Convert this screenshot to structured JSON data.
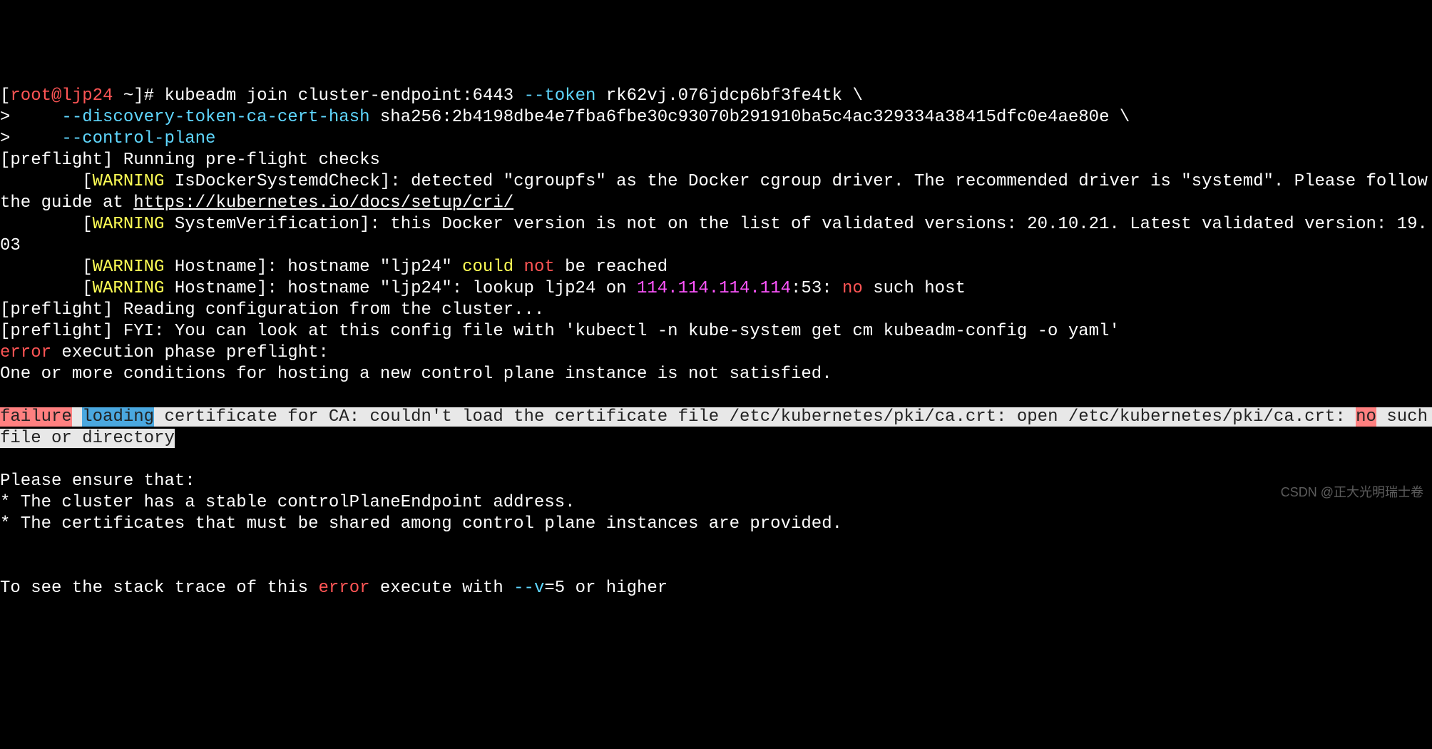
{
  "prompt": {
    "left_bracket": "[",
    "user": "root@ljp24",
    "tilde": " ~",
    "right_seg": "]# ",
    "cmd_kubeadm": "kubeadm ",
    "cmd_join": "join cluster-endpoint:6443 ",
    "flag_token": "--token",
    "token_val": " rk62vj.076jdcp6bf3fe4tk \\",
    "cont1_gt": ">     ",
    "flag_hash": "--discovery-token-ca-cert-hash",
    "hash_val": " sha256:2b4198dbe4e7fba6fbe30c93070b291910ba5c4ac329334a38415dfc0e4ae80e \\",
    "cont2_gt": ">     ",
    "flag_cp": "--control-plane"
  },
  "preflight": {
    "run": "[preflight] Running pre-flight checks",
    "w_open": "        [",
    "w_tag": "WARNING",
    "w1_rest": " IsDockerSystemdCheck]: detected \"cgroupfs\" as the Docker cgroup driver. The recommended driver is \"systemd\". Please follow the guide at ",
    "w1_link": "https://kubernetes.io/docs/setup/cri/",
    "w2_rest": " SystemVerification]: this Docker version is not on the list of validated versions: 20.10.21. Latest validated version: 19.03",
    "w3_rest_a": " Hostname]: hostname \"ljp24\" ",
    "w3_could": "could",
    "w3_sp": " ",
    "w3_not": "not",
    "w3_rest_b": " be reached",
    "w4_rest_a": " Hostname]: hostname \"ljp24\": lookup ljp24 on ",
    "w4_ip": "114.114.114.114",
    "w4_port": ":53: ",
    "w4_no": "no",
    "w4_rest_b": " such host",
    "read": "[preflight] Reading configuration from the cluster...",
    "fyi": "[preflight] FYI: You can look at this config file with 'kubectl -n kube-system get cm kubeadm-config -o yaml'"
  },
  "error": {
    "err_word": "error",
    "exec": " execution phase preflight: ",
    "cond": "One or more conditions for hosting a new control plane instance is not satisfied."
  },
  "failure": {
    "failure": "failure",
    "sp1": " ",
    "loading": "loading",
    "mid_a": " certificate for CA: couldn't load the certificate file /etc/kubernetes/pki/ca.crt: open /etc/kubernetes/pki/ca.crt: ",
    "no": "no",
    "mid_b": " such file or directory"
  },
  "ensure": {
    "head": "Please ensure that:",
    "b1": "* The cluster has a stable controlPlaneEndpoint address.",
    "b2": "* The certificates that must be shared among control plane instances are provided."
  },
  "trace": {
    "a": "To see the stack trace of this ",
    "err": "error",
    "b": " execute with ",
    "flag": "--v",
    "c": "=5 or higher"
  },
  "watermark": "CSDN @正大光明瑞士卷"
}
